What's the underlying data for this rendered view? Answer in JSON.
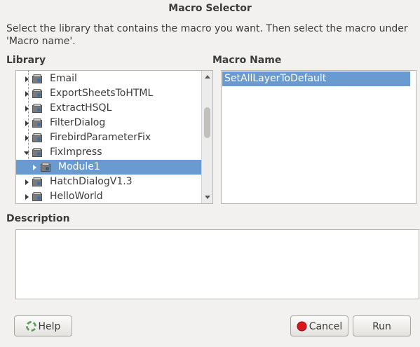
{
  "window": {
    "title": "Macro Selector"
  },
  "instructions": "Select the library that contains the macro you want. Then select the macro under 'Macro name'.",
  "library": {
    "label": "Library",
    "items": [
      {
        "label": "Email",
        "expanded": false,
        "selected": false
      },
      {
        "label": "ExportSheetsToHTML",
        "expanded": false,
        "selected": false
      },
      {
        "label": "ExtractHSQL",
        "expanded": false,
        "selected": false
      },
      {
        "label": "FilterDialog",
        "expanded": false,
        "selected": false
      },
      {
        "label": "FirebirdParameterFix",
        "expanded": false,
        "selected": false
      },
      {
        "label": "FixImpress",
        "expanded": true,
        "selected": false
      },
      {
        "label": "Module1",
        "expanded": false,
        "selected": true,
        "child": true
      },
      {
        "label": "HatchDialogV1.3",
        "expanded": false,
        "selected": false
      },
      {
        "label": "HelloWorld",
        "expanded": false,
        "selected": false
      }
    ]
  },
  "macro_name": {
    "label": "Macro Name",
    "items": [
      "SetAllLayerToDefault"
    ]
  },
  "description": {
    "label": "Description",
    "text": ""
  },
  "buttons": {
    "help": "Help",
    "cancel": "Cancel",
    "run": "Run"
  },
  "colors": {
    "selection": "#6a9bd0",
    "background": "#f2f1f0",
    "cancel_icon": "#d9161a"
  }
}
